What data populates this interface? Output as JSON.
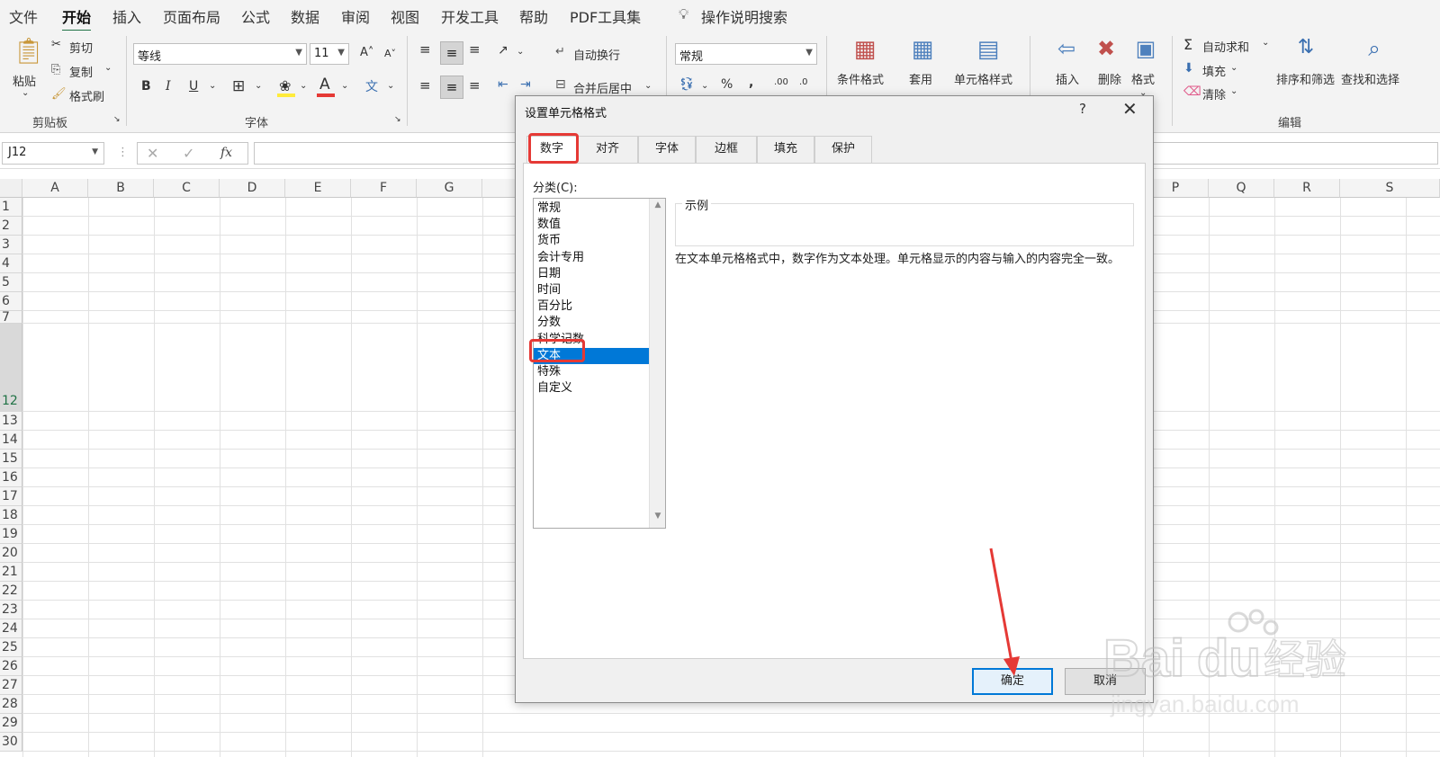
{
  "menu": {
    "items": [
      "文件",
      "开始",
      "插入",
      "页面布局",
      "公式",
      "数据",
      "审阅",
      "视图",
      "开发工具",
      "帮助",
      "PDF工具集"
    ],
    "active": "开始",
    "search": "操作说明搜索"
  },
  "ribbon": {
    "clipboard": {
      "paste": "粘贴",
      "cut": "剪切",
      "copy": "复制",
      "format_painter": "格式刷",
      "group": "剪贴板"
    },
    "font": {
      "name": "等线",
      "size": "11",
      "group": "字体",
      "bold": "B",
      "italic": "I",
      "underline": "U",
      "font_color": "A"
    },
    "alignment": {
      "wrap": "自动换行",
      "merge": "合并后居中"
    },
    "number": {
      "format": "常规"
    },
    "styles": {
      "conditional": "条件格式",
      "table": "套用\n表格格式",
      "cell": "单元格样式"
    },
    "cells": {
      "insert": "插入",
      "delete": "删除",
      "format": "格式"
    },
    "editing": {
      "autosum": "自动求和",
      "fill": "填充",
      "clear": "清除",
      "sort": "排序和筛选",
      "find": "查找和选择",
      "group": "编辑"
    }
  },
  "formula_bar": {
    "name_box": "J12",
    "fx": "fx"
  },
  "grid": {
    "columns_left": [
      "A",
      "B",
      "C",
      "D",
      "E",
      "F",
      "G"
    ],
    "columns_right": [
      "P",
      "Q",
      "R",
      "S"
    ],
    "rows": [
      "1",
      "2",
      "3",
      "4",
      "5",
      "6",
      "7",
      "12",
      "13",
      "14",
      "15",
      "16",
      "17",
      "18",
      "19",
      "20",
      "21",
      "22",
      "23",
      "24",
      "25",
      "26",
      "27",
      "28",
      "29",
      "30"
    ]
  },
  "dialog": {
    "title": "设置单元格格式",
    "help": "?",
    "close": "✕",
    "tabs": [
      "数字",
      "对齐",
      "字体",
      "边框",
      "填充",
      "保护"
    ],
    "active_tab": "数字",
    "category_label": "分类(C):",
    "categories": [
      "常规",
      "数值",
      "货币",
      "会计专用",
      "日期",
      "时间",
      "百分比",
      "分数",
      "科学记数",
      "文本",
      "特殊",
      "自定义"
    ],
    "selected_category": "文本",
    "sample_label": "示例",
    "description": "在文本单元格格式中，数字作为文本处理。单元格显示的内容与输入的内容完全一致。",
    "ok": "确定",
    "cancel": "取消"
  },
  "watermark": {
    "brand": "Bai du 经验",
    "url": "jingyan.baidu.com"
  },
  "colors": {
    "accent": "#217346",
    "selection": "#0078d7",
    "highlight": "#e53935"
  }
}
